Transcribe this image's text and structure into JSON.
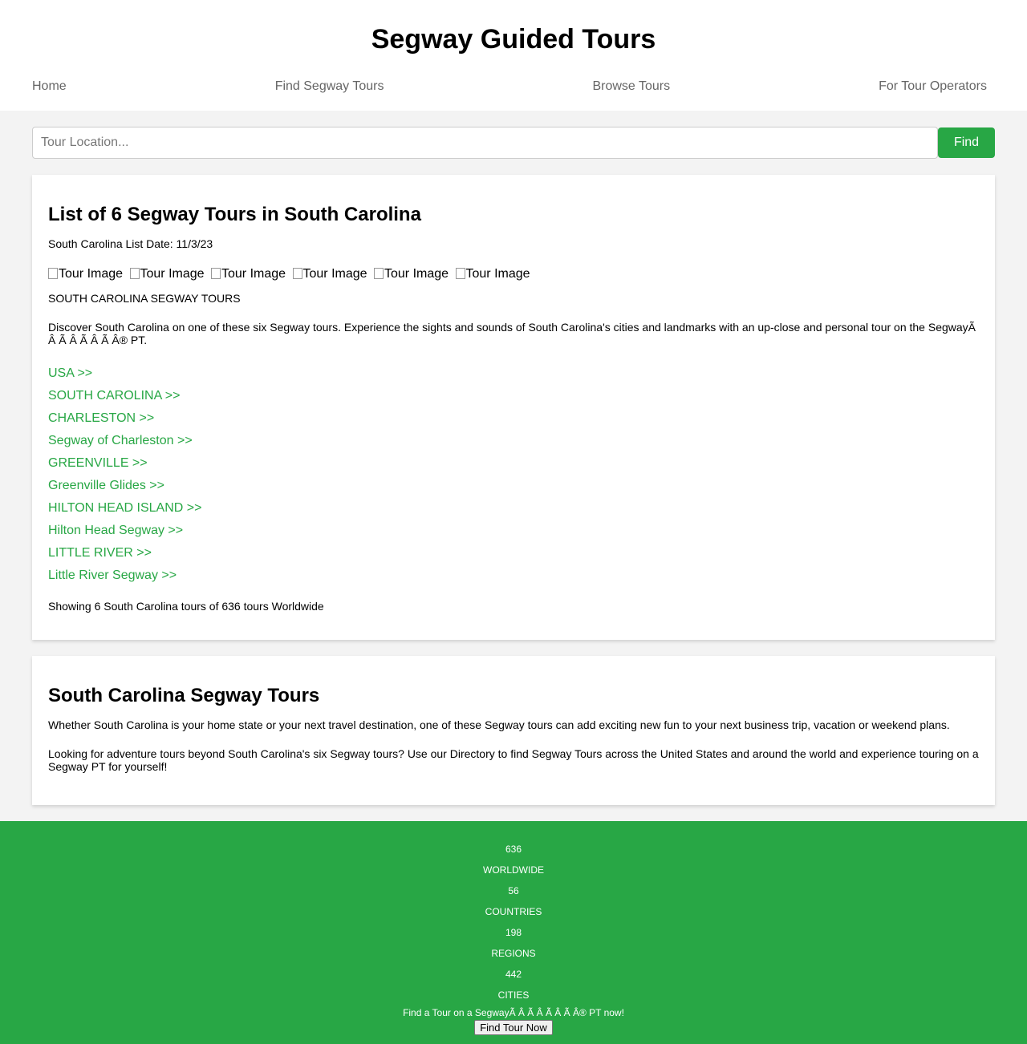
{
  "site": {
    "title": "Segway Guided Tours"
  },
  "nav": [
    "Home",
    "Find Segway Tours",
    "Browse Tours",
    "For Tour Operators"
  ],
  "search": {
    "placeholder": "Tour Location...",
    "button": "Find"
  },
  "list_card": {
    "heading": "List of 6 Segway Tours in South Carolina",
    "list_date": "South Carolina List Date: 11/3/23",
    "image_alt": [
      "Tour Image",
      "Tour Image",
      "Tour Image",
      "Tour Image",
      "Tour Image",
      "Tour Image"
    ],
    "section_label": "SOUTH CAROLINA SEGWAY TOURS",
    "description": "Discover South Carolina on one of these six Segway tours. Experience the sights and sounds of South Carolina's cities and landmarks with an up-close and personal tour on the SegwayÃ   Â   Ã   Â   Ã   Â   Ã   Â® PT.",
    "links": [
      "USA >>",
      "SOUTH CAROLINA >>",
      "CHARLESTON >>",
      "Segway of Charleston >>",
      "GREENVILLE >>",
      "Greenville Glides >>",
      "HILTON HEAD ISLAND >>",
      "Hilton Head Segway >>",
      "LITTLE RIVER >>",
      "Little River Segway >>"
    ],
    "showing": "Showing 6 South Carolina tours of 636 tours Worldwide"
  },
  "info_card": {
    "heading": "South Carolina Segway Tours",
    "p1": "Whether South Carolina is your home state or your next travel destination, one of these Segway tours can add exciting new fun to your next business trip, vacation or weekend plans.",
    "p2": "Looking for adventure tours beyond South Carolina's six Segway tours? Use our Directory to find Segway Tours across the United States and around the world and experience touring on a Segway PT for yourself!"
  },
  "footer": {
    "stats": [
      "636",
      "WORLDWIDE",
      "56",
      "COUNTRIES",
      "198",
      "REGIONS",
      "442",
      "CITIES"
    ],
    "cta": "Find a Tour on a SegwayÃ   Â   Ã   Â   Ã   Â   Ã   Â® PT now!",
    "button": "Find Tour Now",
    "background": "#28a745"
  }
}
